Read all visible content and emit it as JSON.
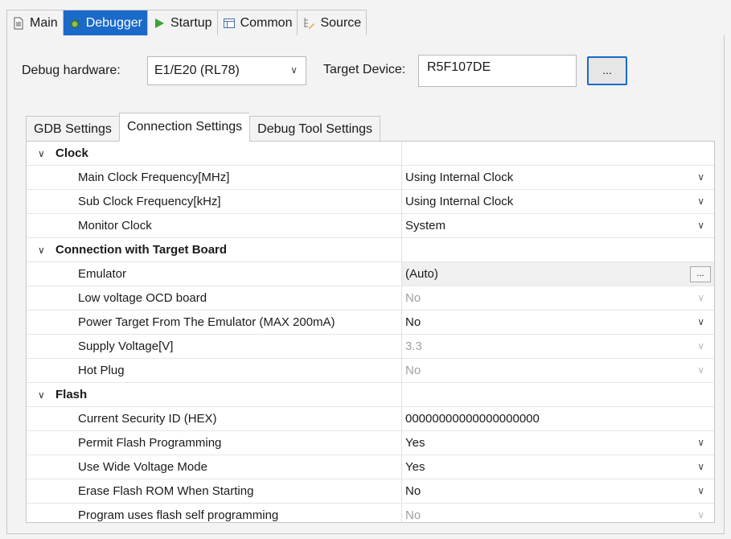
{
  "top_tabs": [
    {
      "label": "Main",
      "icon": "document-icon"
    },
    {
      "label": "Debugger",
      "icon": "bug-icon",
      "active": true
    },
    {
      "label": "Startup",
      "icon": "play-icon"
    },
    {
      "label": "Common",
      "icon": "table-icon"
    },
    {
      "label": "Source",
      "icon": "source-icon"
    }
  ],
  "debug_hardware": {
    "label": "Debug hardware:",
    "value": "E1/E20 (RL78)"
  },
  "target_device": {
    "label": "Target Device:",
    "value": "R5F107DE",
    "button": "..."
  },
  "inner_tabs": [
    {
      "label": "GDB Settings"
    },
    {
      "label": "Connection Settings",
      "active": true
    },
    {
      "label": "Debug Tool Settings"
    }
  ],
  "grid": {
    "clock": {
      "label": "Clock",
      "items": [
        {
          "name": "Main Clock Frequency[MHz]",
          "value": "Using Internal Clock"
        },
        {
          "name": "Sub Clock Frequency[kHz]",
          "value": "Using Internal Clock"
        },
        {
          "name": "Monitor Clock",
          "value": "System"
        }
      ]
    },
    "connection": {
      "label": "Connection with Target Board",
      "items": [
        {
          "name": "Emulator",
          "value": "(Auto)",
          "button": "..."
        },
        {
          "name": "Low voltage OCD board",
          "value": "No"
        },
        {
          "name": "Power Target From The Emulator (MAX 200mA)",
          "value": "No"
        },
        {
          "name": "Supply Voltage[V]",
          "value": "3.3"
        },
        {
          "name": "Hot Plug",
          "value": "No"
        }
      ]
    },
    "flash": {
      "label": "Flash",
      "items": [
        {
          "name": "Current Security ID (HEX)",
          "value": "00000000000000000000"
        },
        {
          "name": "Permit Flash Programming",
          "value": "Yes"
        },
        {
          "name": "Use Wide Voltage Mode",
          "value": "Yes"
        },
        {
          "name": "Erase Flash ROM When Starting",
          "value": "No"
        },
        {
          "name": "Program uses flash self programming",
          "value": "No"
        }
      ]
    }
  },
  "colors": {
    "accent": "#1b6ac9",
    "disabled": "#a0a0a0"
  }
}
